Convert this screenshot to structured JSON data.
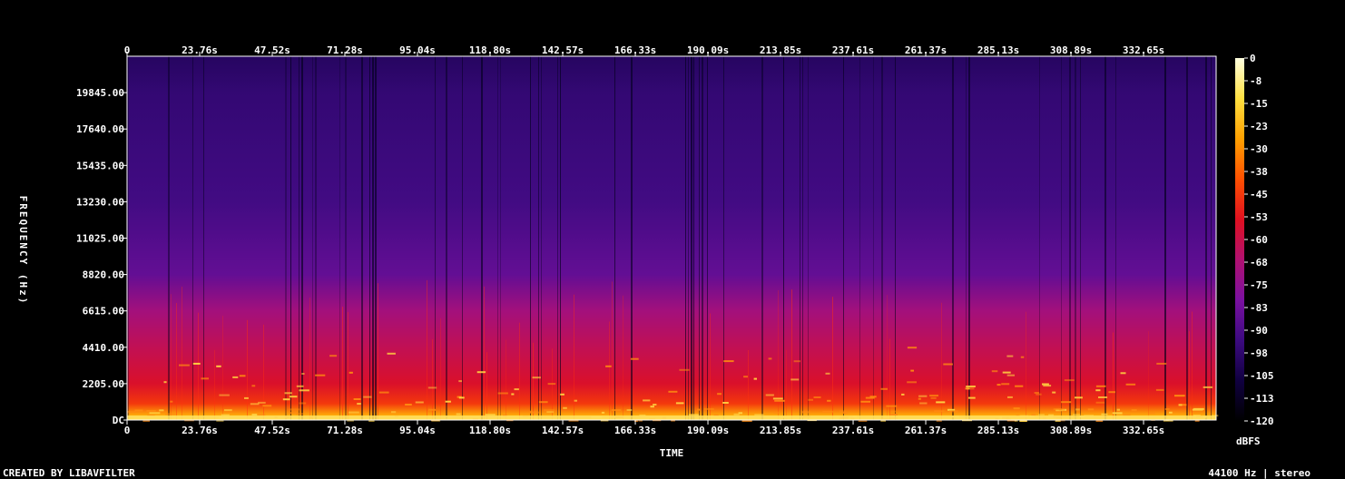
{
  "chart_data": {
    "type": "heatmap",
    "xlabel": "TIME",
    "ylabel": "FREQUENCY (Hz)",
    "x_ticks": [
      "0",
      "23.76s",
      "47.52s",
      "71.28s",
      "95.04s",
      "118.80s",
      "142.57s",
      "166.33s",
      "190.09s",
      "213.85s",
      "237.61s",
      "261.37s",
      "285.13s",
      "308.89s",
      "332.65s"
    ],
    "x_tick_values": [
      0,
      23.76,
      47.52,
      71.28,
      95.04,
      118.8,
      142.57,
      166.33,
      190.09,
      213.85,
      237.61,
      261.37,
      285.13,
      308.89,
      332.65
    ],
    "xlim": [
      0,
      356.4
    ],
    "y_ticks": [
      "DC",
      "2205.00",
      "4410.00",
      "6615.00",
      "8820.00",
      "11025.00",
      "13230.00",
      "15435.00",
      "17640.00",
      "19845.00"
    ],
    "y_tick_values": [
      0,
      2205,
      4410,
      6615,
      8820,
      11025,
      13230,
      15435,
      17640,
      19845
    ],
    "ylim": [
      0,
      22050
    ],
    "colorbar": {
      "label": "dBFS",
      "ticks": [
        "0",
        "-8",
        "-15",
        "-23",
        "-30",
        "-38",
        "-45",
        "-53",
        "-60",
        "-68",
        "-75",
        "-83",
        "-90",
        "-98",
        "-105",
        "-113",
        "-120"
      ],
      "range": [
        -120,
        0
      ],
      "colors": [
        "#000000",
        "#100040",
        "#3c0a80",
        "#7a10a0",
        "#b01070",
        "#e01020",
        "#ff5000",
        "#ffa000",
        "#ffe040",
        "#ffffe0"
      ]
    },
    "energy_profile": {
      "description_level_by_freq_hz": [
        [
          0,
          -15
        ],
        [
          300,
          -25
        ],
        [
          1000,
          -45
        ],
        [
          2205,
          -55
        ],
        [
          4410,
          -62
        ],
        [
          6615,
          -70
        ],
        [
          8820,
          -85
        ],
        [
          13230,
          -92
        ],
        [
          19845,
          -96
        ],
        [
          22050,
          -100
        ]
      ]
    }
  },
  "footer": {
    "left": "CREATED BY LIBAVFILTER",
    "right": "44100 Hz | stereo"
  }
}
